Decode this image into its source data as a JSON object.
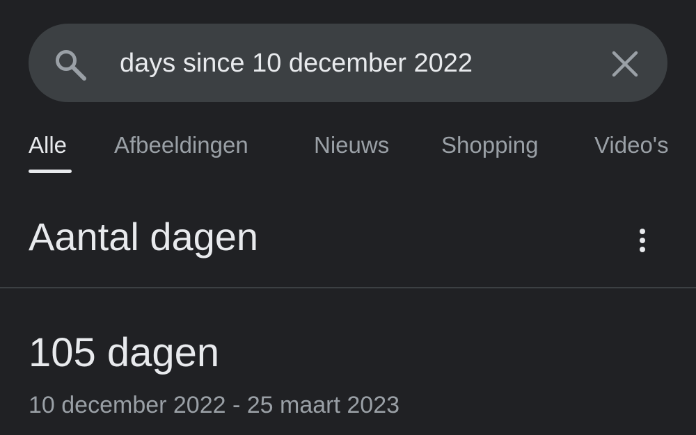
{
  "search": {
    "query": "days since 10 december 2022",
    "search_icon": "search-icon",
    "clear_icon": "close-icon"
  },
  "tabs": [
    {
      "label": "Alle",
      "active": true
    },
    {
      "label": "Afbeeldingen",
      "active": false
    },
    {
      "label": "Nieuws",
      "active": false
    },
    {
      "label": "Shopping",
      "active": false
    },
    {
      "label": "Video's",
      "active": false
    }
  ],
  "result": {
    "title": "Aantal dagen",
    "menu_icon": "more-vert-icon",
    "value": "105 dagen",
    "range": "10 december 2022 - 25 maart 2023"
  },
  "colors": {
    "background": "#202124",
    "search_bar": "#3c4043",
    "text_primary": "#e8eaed",
    "text_secondary": "#9aa0a6"
  }
}
